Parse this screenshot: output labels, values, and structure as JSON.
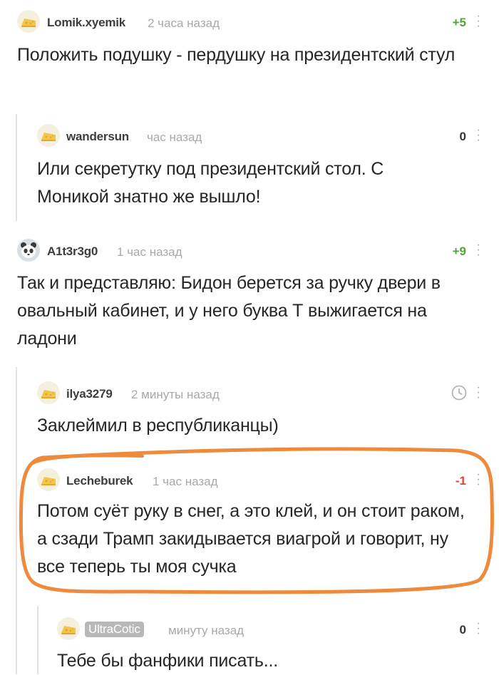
{
  "comments": [
    {
      "username": "Lomik.xyemik",
      "time": "2 часа назад",
      "rating": "+5",
      "text": "Положить подушку - пердушку на президентский стул"
    },
    {
      "username": "wandersun",
      "time": "час назад",
      "rating": "0",
      "text": "Или секретутку под президентский стол. С Моникой знатно же вышло!"
    },
    {
      "username": "A1t3r3g0",
      "time": "1 час назад",
      "rating": "+9",
      "text": "Так и представляю: Бидон берется за ручку двери в овальный кабинет, и у него буква Т выжигается на ладони"
    },
    {
      "username": "ilya3279",
      "time": "2 минуты назад",
      "rating": "",
      "text": "Заклеймил в республиканцы)"
    },
    {
      "username": "Lecheburek",
      "time": "1 час назад",
      "rating": "-1",
      "text": "Потом суёт руку в снег, а это клей, и он стоит раком, а сзади Трамп закидывается виагрой и говорит, ну все теперь ты моя сучка"
    },
    {
      "username": "UltraCotic",
      "time": "минуту назад",
      "rating": "0",
      "text": "Тебе бы фанфики писать..."
    }
  ],
  "colors": {
    "positive": "#4ea43a",
    "negative": "#e0433c",
    "highlight_stroke": "#ee8a3c"
  },
  "icons": [
    "cheese-avatar-icon",
    "panda-avatar-icon",
    "clock-icon",
    "more-vert-icon"
  ]
}
